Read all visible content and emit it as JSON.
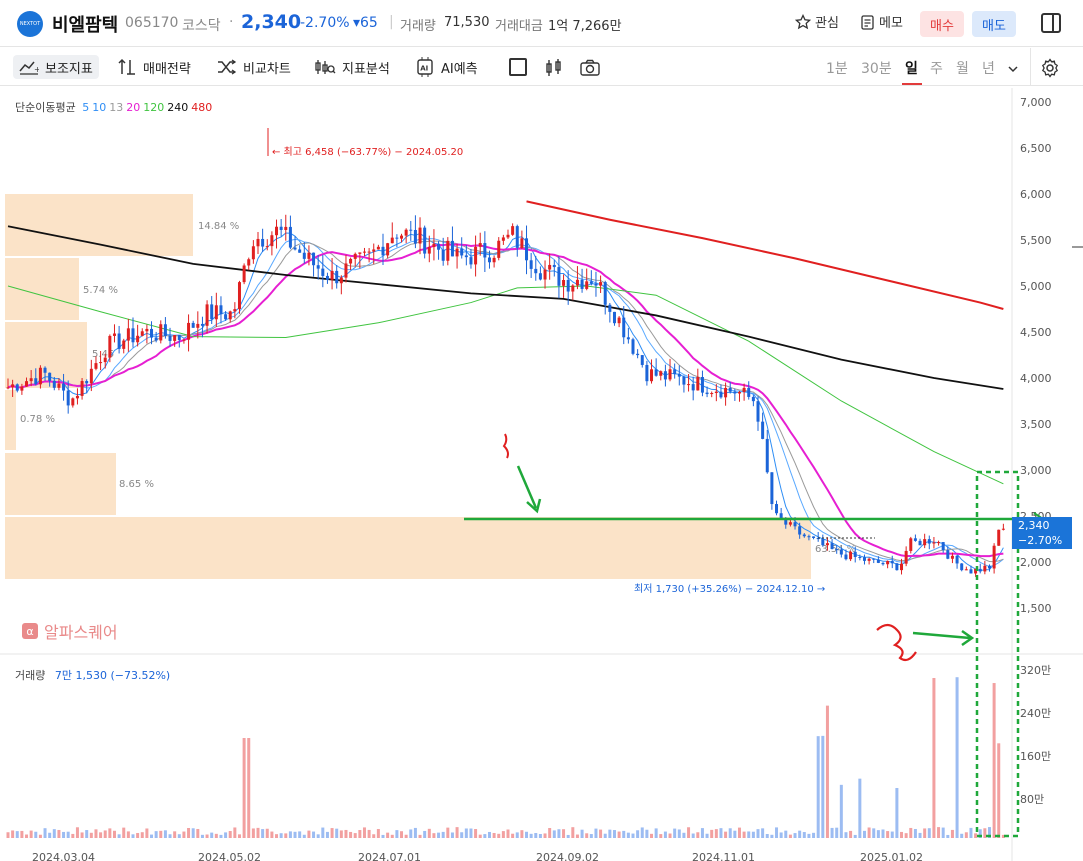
{
  "stock": {
    "logo_text": "NEXTOT",
    "name": "비엘팜텍",
    "code": "065170",
    "market": "코스닥",
    "separator": "·",
    "price": "2,340",
    "change_pct": "-2.70%",
    "change": "▾65",
    "volume_label": "거래량",
    "volume": "71,530",
    "amount_label": "거래대금",
    "amount": "1억 7,266만"
  },
  "header_actions": {
    "watch": "관심",
    "memo": "메모",
    "buy": "매수",
    "sell": "매도"
  },
  "toolbar": {
    "indicators": "보조지표",
    "strategy": "매매전략",
    "compare": "비교차트",
    "analysis": "지표분석",
    "ai": "AI예측",
    "periods": [
      "1분",
      "30분",
      "일",
      "주",
      "월",
      "년"
    ],
    "active_period": "일"
  },
  "legend": {
    "title": "단순이동평균",
    "items": [
      {
        "label": "5",
        "color": "#2f8ef5"
      },
      {
        "label": "10",
        "color": "#2f8ef5"
      },
      {
        "label": "13",
        "color": "#9a9a9a"
      },
      {
        "label": "20",
        "color": "#e61fd2"
      },
      {
        "label": "120",
        "color": "#40c440"
      },
      {
        "label": "240",
        "color": "#111111"
      },
      {
        "label": "480",
        "color": "#e02020"
      }
    ]
  },
  "volume_legend": {
    "label": "거래량",
    "value": "7만 1,530 (−73.52%)"
  },
  "watermark": "알파스퀘어",
  "price_tag": {
    "price": "2,340",
    "pct": "−2.70%"
  },
  "chart_data": {
    "type": "candlestick",
    "y_axis": [
      "7,000",
      "6,500",
      "6,000",
      "5,500",
      "5,000",
      "4,500",
      "4,000",
      "3,500",
      "3,000",
      "2,500",
      "2,000",
      "1,500"
    ],
    "volume_axis": [
      "320만",
      "240만",
      "160만",
      "80만"
    ],
    "x_axis": [
      "2024.03.04",
      "2024.05.02",
      "2024.07.01",
      "2024.09.02",
      "2024.11.01",
      "2025.01.02"
    ],
    "ylim": [
      1000,
      7200
    ],
    "annotations": {
      "high": "최고 6,458 (−63.77%) − 2024.05.20",
      "low": "최저 1,730 (+35.26%) − 2024.12.10",
      "profile_pcts": [
        "14.84 %",
        "5.74 %",
        "5.45",
        "0.78 %",
        "8.65 %",
        "63.54 %"
      ]
    },
    "moving_averages": {
      "ma120": [
        [
          0,
          5.0
        ],
        [
          20,
          4.72
        ],
        [
          40,
          4.45
        ],
        [
          60,
          4.44
        ],
        [
          80,
          4.6
        ],
        [
          100,
          4.82
        ],
        [
          110,
          4.98
        ],
        [
          125,
          5.0
        ],
        [
          140,
          4.9
        ],
        [
          160,
          4.4
        ],
        [
          180,
          3.75
        ],
        [
          200,
          3.2
        ],
        [
          215,
          2.85
        ]
      ],
      "ma240": [
        [
          0,
          5.65
        ],
        [
          20,
          5.45
        ],
        [
          40,
          5.24
        ],
        [
          60,
          5.12
        ],
        [
          80,
          5.02
        ],
        [
          100,
          4.92
        ],
        [
          120,
          4.86
        ],
        [
          140,
          4.68
        ],
        [
          160,
          4.45
        ],
        [
          180,
          4.2
        ],
        [
          200,
          4.0
        ],
        [
          215,
          3.88
        ]
      ],
      "ma480": [
        [
          112,
          5.92
        ],
        [
          130,
          5.72
        ],
        [
          150,
          5.52
        ],
        [
          170,
          5.3
        ],
        [
          190,
          5.06
        ],
        [
          210,
          4.82
        ],
        [
          215,
          4.75
        ]
      ]
    }
  }
}
